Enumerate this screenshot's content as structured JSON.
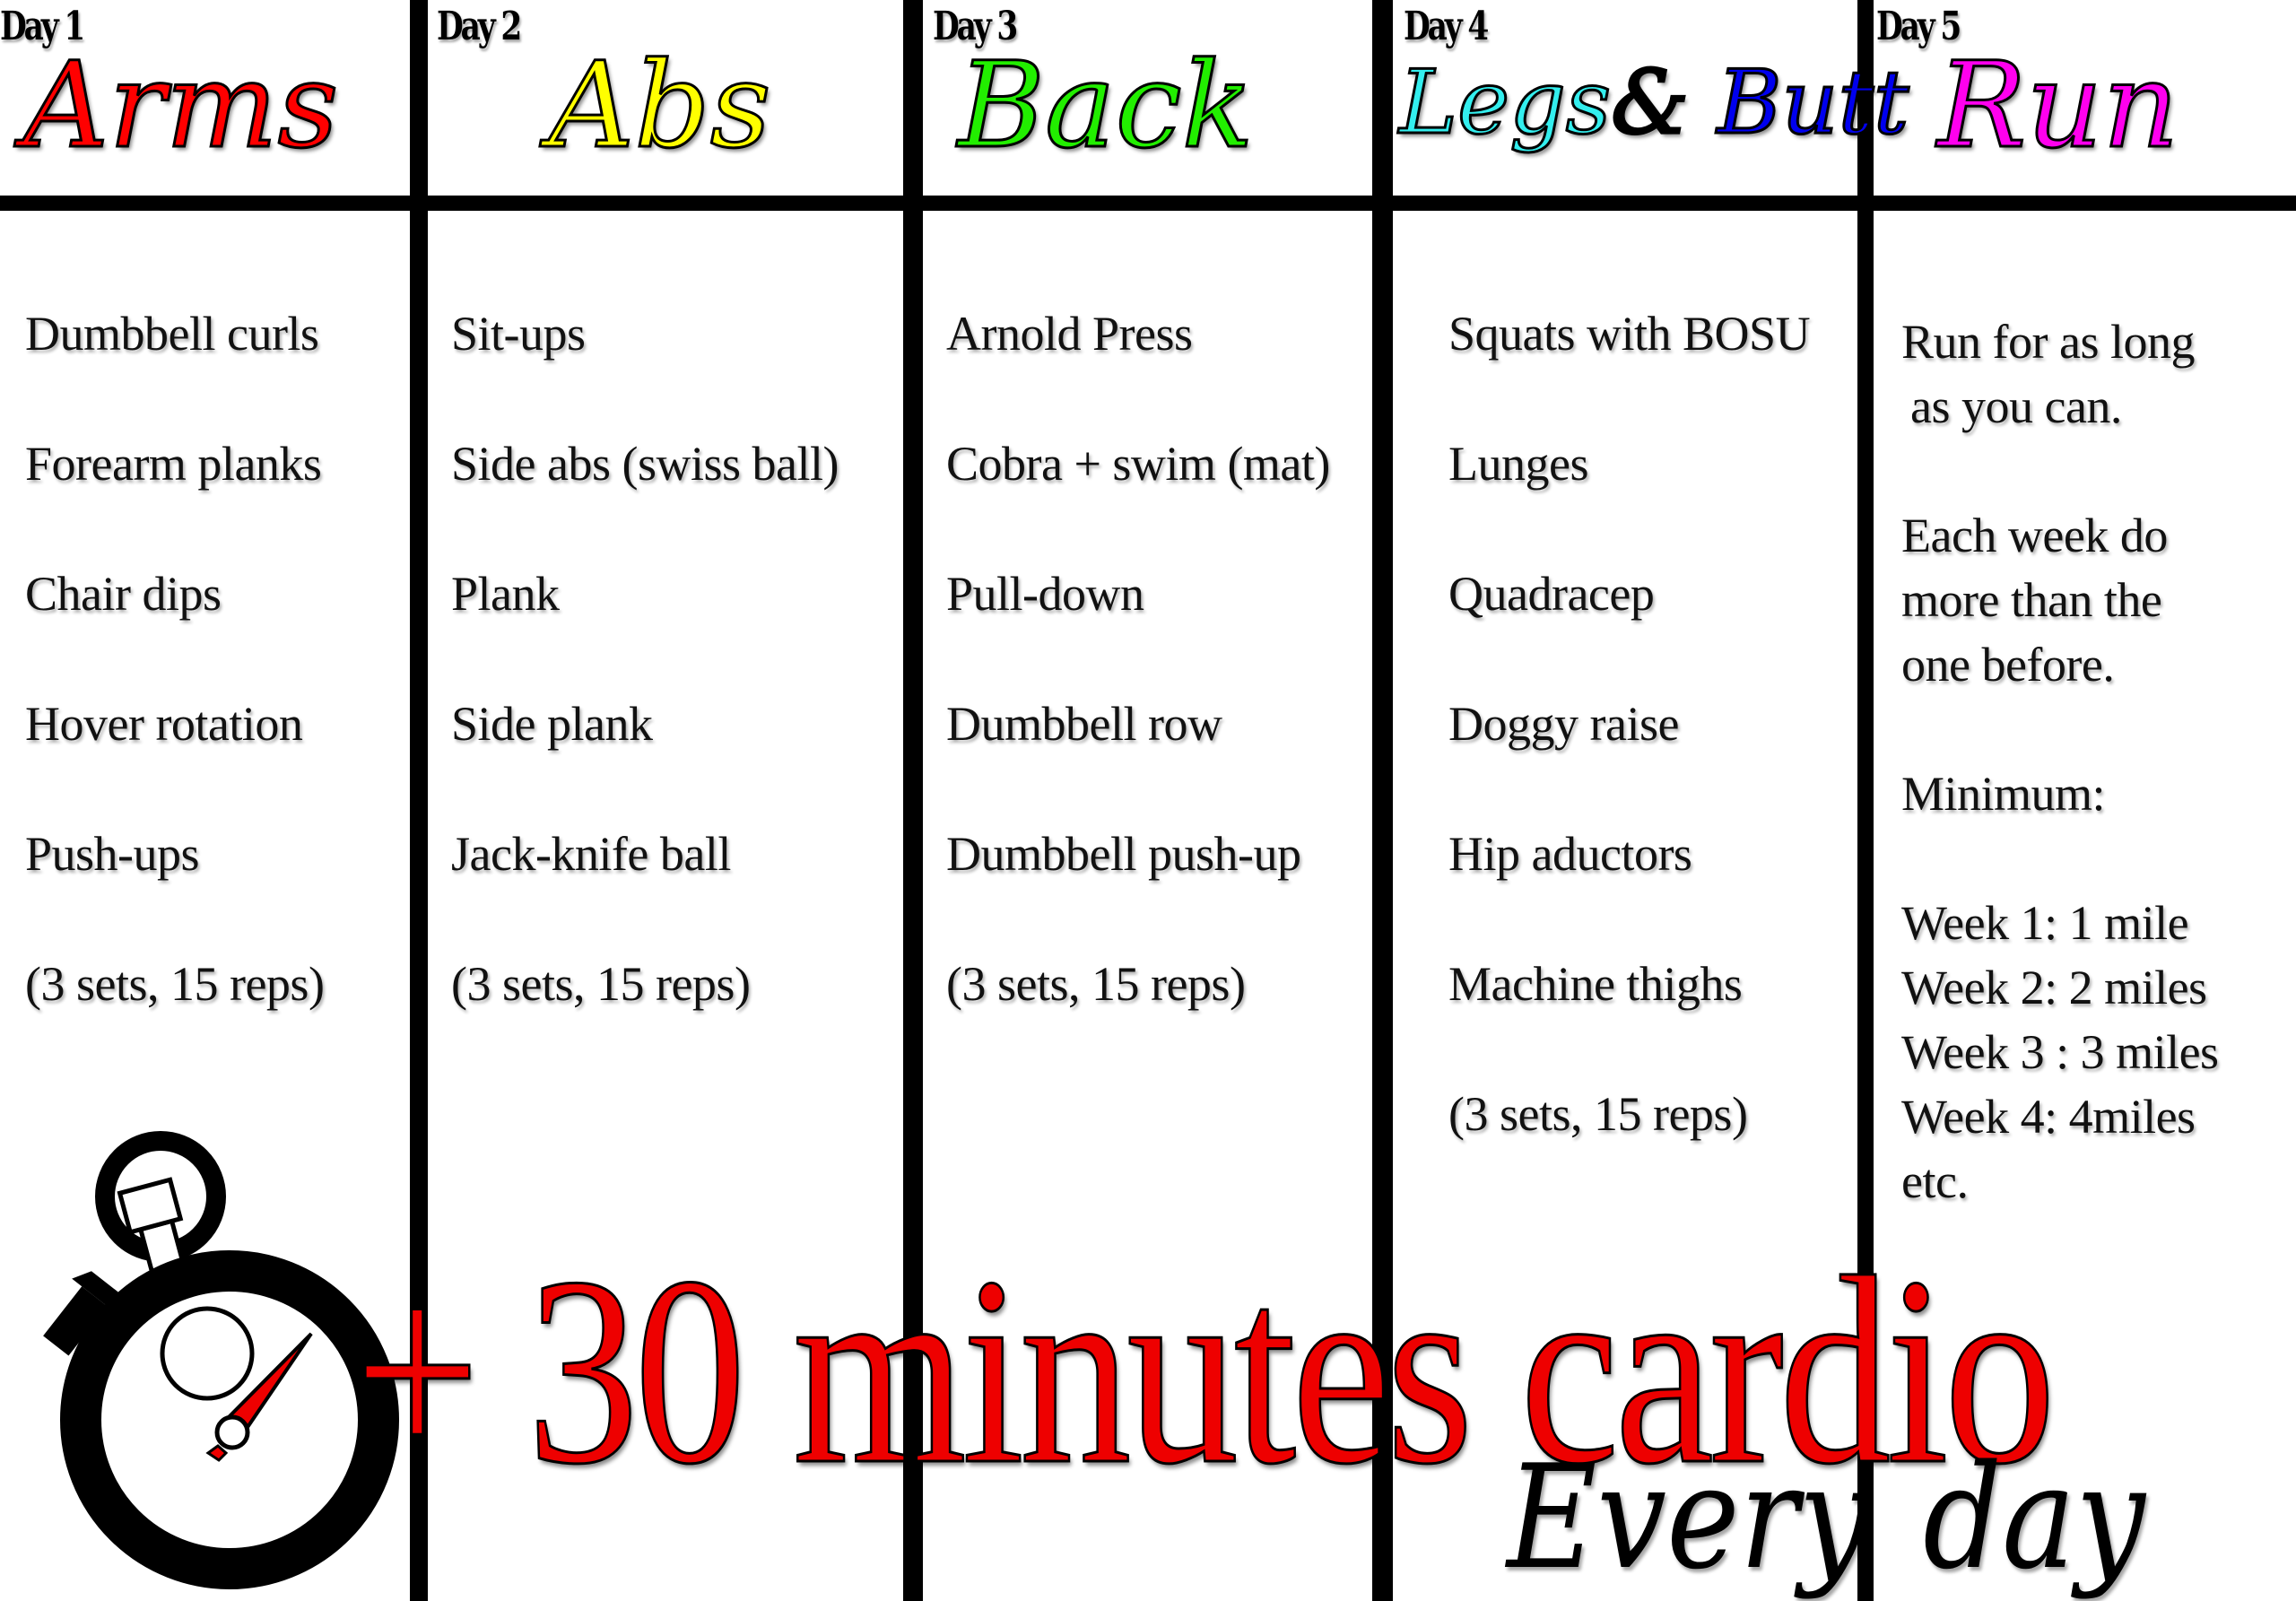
{
  "days": [
    {
      "day_label": "Day 1",
      "title": "Arms",
      "title_color": "#ff0000",
      "exercises": [
        "Dumbbell curls",
        "Forearm planks",
        "Chair dips",
        "Hover rotation",
        "Push-ups",
        "(3 sets, 15 reps)"
      ]
    },
    {
      "day_label": "Day 2",
      "title": "Abs",
      "title_color": "#ffff00",
      "exercises": [
        "Sit-ups",
        "Side abs (swiss ball)",
        "Plank",
        "Side plank",
        "Jack-knife ball",
        "(3 sets, 15 reps)"
      ]
    },
    {
      "day_label": "Day 3",
      "title": "Back",
      "title_color": "#22ee00",
      "exercises": [
        "Arnold Press",
        "Cobra + swim (mat)",
        "Pull-down",
        "Dumbbell row",
        "Dumbbell push-up",
        "(3 sets, 15 reps)"
      ]
    },
    {
      "day_label": "Day 4",
      "title_part1": "Legs",
      "title_part1_color": "#33eeee",
      "title_amp": "&",
      "title_part2": "Butt",
      "title_part2_color": "#0000ee",
      "exercises": [
        "Squats with BOSU",
        "Lunges",
        "Quadracep",
        "Doggy raise",
        "Hip aductors",
        "Machine thighs",
        "(3 sets, 15 reps)"
      ]
    },
    {
      "day_label": "Day 5",
      "title": "Run",
      "title_color": "#ff00ee",
      "lines": {
        "intro_1": "Run for as long",
        "intro_2": "as you can.",
        "each_1": "Each week do",
        "each_2": "more than the",
        "each_3": "one before.",
        "minimum": "Minimum:",
        "week1": "Week 1: 1 mile",
        "week2": "Week 2: 2 miles",
        "week3": "Week 3 : 3 miles",
        "week4": "Week 4: 4miles",
        "etc": "etc."
      }
    }
  ],
  "footer": {
    "cardio": "+ 30 minutes cardio",
    "every_day": "Every day",
    "cardio_color": "#ee0000",
    "stopwatch_icon": "stopwatch-icon"
  }
}
